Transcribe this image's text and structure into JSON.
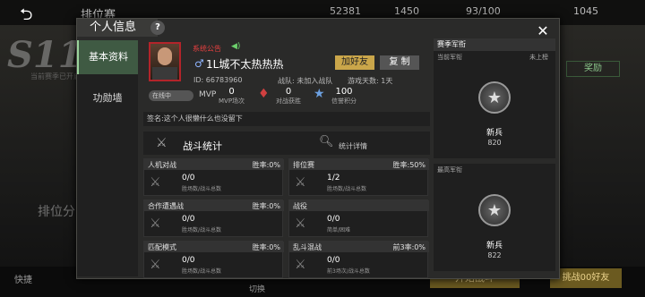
{
  "background": {
    "title": "排位赛",
    "season": "S11",
    "season_sub": "当前赛季已开启挑战赛",
    "left_label": "排位分",
    "quick_label": "快捷",
    "switch_label": "切换",
    "resources": [
      "52381",
      "1450",
      "93/100",
      "1045"
    ],
    "right_btn_1": "奖励",
    "right_btn_2": "开始战斗",
    "right_btn_3": "挑战00好友"
  },
  "dialog": {
    "title": "个人信息",
    "help": "?",
    "close": "✕",
    "nav": [
      "基本资料",
      "功勋墙"
    ],
    "profile": {
      "system_notice": "系统公告",
      "name": "1L城不太热热热",
      "add_friend": "加好友",
      "copy": "复 制",
      "id_label": "ID: 66783960",
      "team_label": "战队: 未加入战队",
      "days_label": "游戏天数: 1天",
      "status": "在线中",
      "stats": [
        {
          "value": "0",
          "label": "MVP场次"
        },
        {
          "value": "0",
          "label": "对战获胜"
        },
        {
          "value": "100",
          "label": "信誉积分"
        }
      ],
      "signature": "签名:这个人很懒什么也没留下"
    },
    "battle": {
      "title": "战斗统计",
      "detail": "统计详情",
      "cells": [
        {
          "name": "人机对战",
          "rate": "胜率:0%",
          "value": "0/0",
          "sub": "胜场数/战斗总数"
        },
        {
          "name": "排位赛",
          "rate": "胜率:50%",
          "value": "1/2",
          "sub": "胜场数/战斗总数"
        },
        {
          "name": "合作遭遇战",
          "rate": "胜率:0%",
          "value": "0/0",
          "sub": "胜场数/战斗总数"
        },
        {
          "name": "战役",
          "rate": "",
          "value": "0/0",
          "sub": "简单/困难"
        },
        {
          "name": "匹配模式",
          "rate": "胜率:0%",
          "value": "0/0",
          "sub": "胜场数/战斗总数"
        },
        {
          "name": "乱斗混战",
          "rate": "前3率:0%",
          "value": "0/0",
          "sub": "前3场次/战斗总数"
        }
      ]
    },
    "rank": {
      "title": "赛季军衔",
      "current_label": "当前军衔",
      "current_status": "未上榜",
      "current_name": "新兵",
      "current_points": "820",
      "highest_label": "最高军衔",
      "highest_name": "新兵",
      "highest_points": "822"
    }
  },
  "colors": {
    "accent_green": "#3f5a43",
    "gold": "#caa64a",
    "red": "#b3242a"
  }
}
